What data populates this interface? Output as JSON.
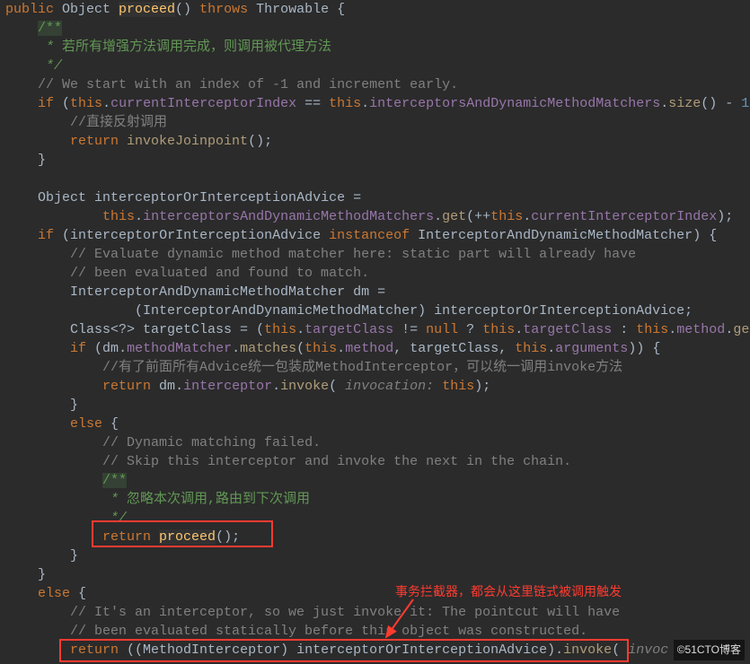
{
  "language": "java",
  "tokens": [
    [
      [
        "kw",
        "public "
      ],
      [
        "type",
        "Object "
      ],
      [
        "method-decl",
        "proceed"
      ],
      [
        "paren",
        "() "
      ],
      [
        "throws",
        "throws "
      ],
      [
        "exc",
        "Throwable "
      ],
      [
        "brace",
        "{"
      ]
    ],
    [
      [
        "",
        "    "
      ],
      [
        "doc-hl",
        "/**"
      ]
    ],
    [
      [
        "",
        "     "
      ],
      [
        "doc",
        "* "
      ],
      [
        "doc-cn",
        "若所有增强方法调用完成，则调用被代理方法"
      ]
    ],
    [
      [
        "",
        "     "
      ],
      [
        "doc",
        "*/"
      ]
    ],
    [
      [
        "",
        "    "
      ],
      [
        "comment",
        "// We start with an index of -1 and increment early."
      ]
    ],
    [
      [
        "",
        "    "
      ],
      [
        "kw",
        "if "
      ],
      [
        "paren",
        "("
      ],
      [
        "this",
        "this"
      ],
      [
        "op",
        "."
      ],
      [
        "field",
        "currentInterceptorIndex"
      ],
      [
        "op",
        " == "
      ],
      [
        "this",
        "this"
      ],
      [
        "op",
        "."
      ],
      [
        "field",
        "interceptorsAndDynamicMethodMatchers"
      ],
      [
        "op",
        "."
      ],
      [
        "call",
        "size"
      ],
      [
        "paren",
        "()"
      ],
      [
        "op",
        " - "
      ],
      [
        "num",
        "1"
      ],
      [
        "paren",
        ")"
      ]
    ],
    [
      [
        "",
        "        "
      ],
      [
        "comment",
        "//直接反射调用"
      ]
    ],
    [
      [
        "",
        "        "
      ],
      [
        "kw",
        "return "
      ],
      [
        "call",
        "invokeJoinpoint"
      ],
      [
        "paren",
        "()"
      ],
      [
        "op",
        ";"
      ]
    ],
    [
      [
        "",
        "    "
      ],
      [
        "brace",
        "}"
      ]
    ],
    [
      [
        "",
        ""
      ]
    ],
    [
      [
        "",
        "    "
      ],
      [
        "type",
        "Object interceptorOrInterceptionAdvice ="
      ]
    ],
    [
      [
        "",
        "            "
      ],
      [
        "this",
        "this"
      ],
      [
        "op",
        "."
      ],
      [
        "field",
        "interceptorsAndDynamicMethodMatchers"
      ],
      [
        "op",
        "."
      ],
      [
        "call",
        "get"
      ],
      [
        "paren",
        "("
      ],
      [
        "op",
        "++"
      ],
      [
        "this",
        "this"
      ],
      [
        "op",
        "."
      ],
      [
        "field",
        "currentInterceptorIndex"
      ],
      [
        "paren",
        ")"
      ],
      [
        "op",
        ";"
      ]
    ],
    [
      [
        "",
        "    "
      ],
      [
        "kw",
        "if "
      ],
      [
        "paren",
        "("
      ],
      [
        "type",
        "interceptorOrInterceptionAdvice "
      ],
      [
        "kw",
        "instanceof "
      ],
      [
        "type",
        "InterceptorAndDynamicMethodMatcher"
      ],
      [
        "paren",
        ") "
      ],
      [
        "brace",
        "{"
      ]
    ],
    [
      [
        "",
        "        "
      ],
      [
        "comment",
        "// Evaluate dynamic method matcher here: static part will already have"
      ]
    ],
    [
      [
        "",
        "        "
      ],
      [
        "comment",
        "// been evaluated and found to match."
      ]
    ],
    [
      [
        "",
        "        "
      ],
      [
        "type",
        "InterceptorAndDynamicMethodMatcher dm ="
      ]
    ],
    [
      [
        "",
        "                "
      ],
      [
        "paren",
        "("
      ],
      [
        "type",
        "InterceptorAndDynamicMethodMatcher"
      ],
      [
        "paren",
        ") "
      ],
      [
        "type",
        "interceptorOrInterceptionAdvice"
      ],
      [
        "op",
        ";"
      ]
    ],
    [
      [
        "",
        "        "
      ],
      [
        "type",
        "Class<?> targetClass = "
      ],
      [
        "paren",
        "("
      ],
      [
        "this",
        "this"
      ],
      [
        "op",
        "."
      ],
      [
        "field",
        "targetClass"
      ],
      [
        "op",
        " != "
      ],
      [
        "kw",
        "null"
      ],
      [
        "op",
        " ? "
      ],
      [
        "this",
        "this"
      ],
      [
        "op",
        "."
      ],
      [
        "field",
        "targetClass"
      ],
      [
        "op",
        " : "
      ],
      [
        "this",
        "this"
      ],
      [
        "op",
        "."
      ],
      [
        "field",
        "method"
      ],
      [
        "op",
        "."
      ],
      [
        "call",
        "get"
      ]
    ],
    [
      [
        "",
        "        "
      ],
      [
        "kw",
        "if "
      ],
      [
        "paren",
        "("
      ],
      [
        "type",
        "dm"
      ],
      [
        "op",
        "."
      ],
      [
        "field",
        "methodMatcher"
      ],
      [
        "op",
        "."
      ],
      [
        "call",
        "matches"
      ],
      [
        "paren",
        "("
      ],
      [
        "this",
        "this"
      ],
      [
        "op",
        "."
      ],
      [
        "field",
        "method"
      ],
      [
        "op",
        ", "
      ],
      [
        "type",
        "targetClass"
      ],
      [
        "op",
        ", "
      ],
      [
        "this",
        "this"
      ],
      [
        "op",
        "."
      ],
      [
        "field",
        "arguments"
      ],
      [
        "paren",
        "))"
      ],
      [
        "brace",
        " {"
      ]
    ],
    [
      [
        "",
        "            "
      ],
      [
        "comment",
        "//有了前面所有Advice统一包装成MethodInterceptor，可以统一调用invoke方法"
      ]
    ],
    [
      [
        "",
        "            "
      ],
      [
        "kw",
        "return "
      ],
      [
        "type",
        "dm"
      ],
      [
        "op",
        "."
      ],
      [
        "field",
        "interceptor"
      ],
      [
        "op",
        "."
      ],
      [
        "call",
        "invoke"
      ],
      [
        "paren",
        "( "
      ],
      [
        "param",
        "invocation: "
      ],
      [
        "this",
        "this"
      ],
      [
        "paren",
        ")"
      ],
      [
        "op",
        ";"
      ]
    ],
    [
      [
        "",
        "        "
      ],
      [
        "brace",
        "}"
      ]
    ],
    [
      [
        "",
        "        "
      ],
      [
        "kw",
        "else "
      ],
      [
        "brace",
        "{"
      ]
    ],
    [
      [
        "",
        "            "
      ],
      [
        "comment",
        "// Dynamic matching failed."
      ]
    ],
    [
      [
        "",
        "            "
      ],
      [
        "comment",
        "// Skip this interceptor and invoke the next in the chain."
      ]
    ],
    [
      [
        "",
        "            "
      ],
      [
        "doc-hl",
        "/**"
      ]
    ],
    [
      [
        "",
        "             "
      ],
      [
        "doc",
        "* "
      ],
      [
        "doc-cn",
        "忽略本次调用,路由到下次调用"
      ]
    ],
    [
      [
        "",
        "             "
      ],
      [
        "doc",
        "*/"
      ]
    ],
    [
      [
        "",
        "            "
      ],
      [
        "kw",
        "return "
      ],
      [
        "method-decl",
        "proceed"
      ],
      [
        "paren",
        "()"
      ],
      [
        "op",
        ";"
      ]
    ],
    [
      [
        "",
        "        "
      ],
      [
        "brace",
        "}"
      ]
    ],
    [
      [
        "",
        "    "
      ],
      [
        "brace",
        "}"
      ]
    ],
    [
      [
        "",
        "    "
      ],
      [
        "kw",
        "else "
      ],
      [
        "brace",
        "{"
      ]
    ],
    [
      [
        "",
        "        "
      ],
      [
        "comment",
        "// It's an interceptor, so we just invoke it: The pointcut will have"
      ]
    ],
    [
      [
        "",
        "        "
      ],
      [
        "comment",
        "// been evaluated statically before this object was constructed."
      ]
    ],
    [
      [
        "",
        "        "
      ],
      [
        "kw",
        "return "
      ],
      [
        "paren",
        "(("
      ],
      [
        "type",
        "MethodInterceptor"
      ],
      [
        "paren",
        ") "
      ],
      [
        "type",
        "interceptorOrInterceptionAdvice"
      ],
      [
        "paren",
        ")"
      ],
      [
        "op",
        "."
      ],
      [
        "call",
        "invoke"
      ],
      [
        "paren",
        "( "
      ],
      [
        "param",
        "invoc"
      ]
    ]
  ],
  "annotation_text": "事务拦截器，都会从这里链式被调用触发",
  "watermark": "©51CTO博客"
}
